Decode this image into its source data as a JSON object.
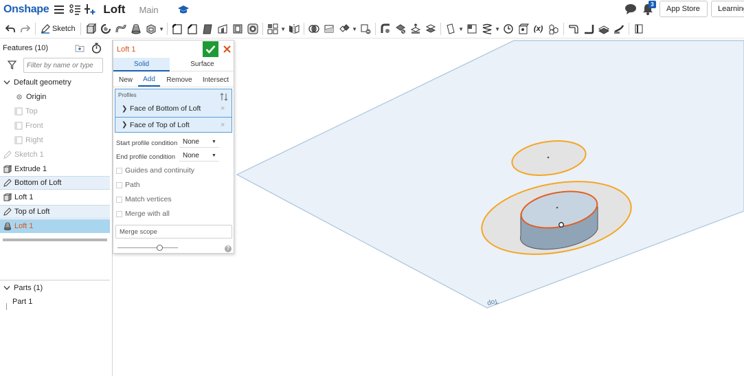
{
  "app": {
    "logo": "Onshape",
    "document_title": "Loft",
    "branch": "Main"
  },
  "header": {
    "notification_count": "3",
    "app_store_label": "App Store",
    "learning_label": "Learning"
  },
  "toolbar": {
    "sketch_label": "Sketch",
    "variable_label": "(x)"
  },
  "features": {
    "header": "Features (10)",
    "filter_placeholder": "Filter by name or type",
    "default_geometry": "Default geometry",
    "origin": "Origin",
    "plane_top": "Top",
    "plane_front": "Front",
    "plane_right": "Right",
    "items": [
      "Sketch 1",
      "Extrude 1",
      "Bottom of Loft",
      "Loft 1",
      "Top of Loft",
      "Loft 1"
    ],
    "parts_header": "Parts (1)",
    "parts": [
      "Part 1"
    ]
  },
  "loft": {
    "title": "Loft 1",
    "tabs": [
      "Solid",
      "Surface"
    ],
    "operations": [
      "New",
      "Add",
      "Remove",
      "Intersect"
    ],
    "profiles_label": "Profiles",
    "profiles": [
      "Face of Bottom of Loft",
      "Face of Top of Loft"
    ],
    "start_condition_label": "Start profile condition",
    "start_condition_value": "None",
    "end_condition_label": "End profile condition",
    "end_condition_value": "None",
    "options": [
      "Guides and continuity",
      "Path",
      "Match vertices",
      "Merge with all"
    ],
    "merge_scope_placeholder": "Merge scope",
    "help": "?"
  },
  "viewport": {
    "plane_label": "Top"
  },
  "colors": {
    "brand": "#1a5fb4",
    "accent": "#d8551a",
    "confirm": "#1e9b35",
    "highlight": "#f5a623"
  }
}
